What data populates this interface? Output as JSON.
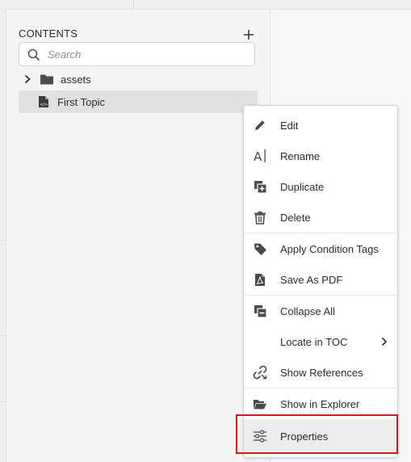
{
  "panel": {
    "title": "CONTENTS",
    "add_button_icon": "plus-icon"
  },
  "search": {
    "placeholder": "Search",
    "value": ""
  },
  "tree": {
    "items": [
      {
        "label": "assets",
        "type": "folder",
        "expanded": false,
        "icon": "folder-icon"
      },
      {
        "label": "First Topic",
        "type": "topic",
        "selected": true,
        "icon": "dita-topic-icon"
      }
    ]
  },
  "context_menu": {
    "items": [
      {
        "label": "Edit",
        "icon": "pencil-icon"
      },
      {
        "label": "Rename",
        "icon": "rename-icon"
      },
      {
        "label": "Duplicate",
        "icon": "duplicate-icon"
      },
      {
        "label": "Delete",
        "icon": "trash-icon"
      },
      {
        "label": "Apply Condition Tags",
        "icon": "tag-icon"
      },
      {
        "label": "Save As PDF",
        "icon": "pdf-icon"
      },
      {
        "label": "Collapse All",
        "icon": "collapse-icon"
      },
      {
        "label": "Locate in TOC",
        "icon": "chevron-right-icon",
        "has_submenu": true
      },
      {
        "label": "Show References",
        "icon": "link-icon"
      },
      {
        "label": "Show in Explorer",
        "icon": "folder-open-icon"
      },
      {
        "label": "Properties",
        "icon": "properties-icon",
        "highlighted": true
      }
    ]
  },
  "colors": {
    "highlight_border": "#d7161b",
    "selected_row": "#e1e1e1",
    "panel_bg": "#f5f5f5",
    "menu_bg": "#ffffff"
  }
}
